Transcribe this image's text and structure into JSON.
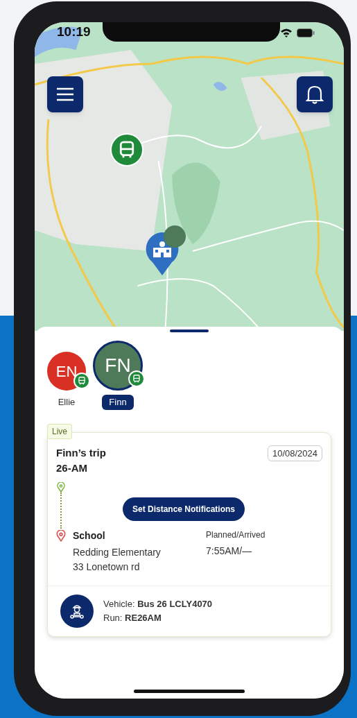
{
  "status_bar": {
    "time": "10:19"
  },
  "students": [
    {
      "initials": "EN",
      "name": "Ellie",
      "color": "#d93025",
      "selected": false
    },
    {
      "initials": "FN",
      "name": "Finn",
      "color": "#4e7a5a",
      "selected": true
    }
  ],
  "trip": {
    "badge": "Live",
    "title": "Finn’s trip",
    "route": "26-AM",
    "date": "10/08/2024",
    "button": "Set Distance Notifications",
    "stop": {
      "name": "School",
      "place": "Redding Elementary",
      "address": "33 Lonetown rd"
    },
    "times_label": "Planned/Arrived",
    "times": "7:55AM/—",
    "vehicle": "Vehicle: **Bus 26 LCLY4070**",
    "run": "Run: **RE26AM**"
  }
}
